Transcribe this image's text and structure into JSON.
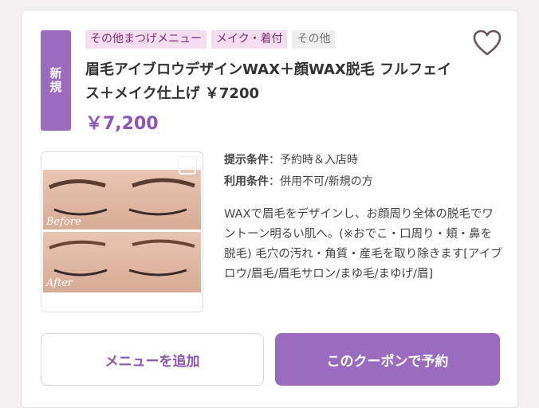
{
  "coupon": {
    "badge": "新規",
    "tags": [
      "その他まつげメニュー",
      "メイク・着付",
      "その他"
    ],
    "title": "眉毛アイブロウデザインWAX＋顔WAX脱毛 フルフェイス＋メイク仕上げ ￥7200",
    "price": "￥7,200",
    "photo_labels": {
      "before": "Before",
      "after": "After"
    },
    "conditions": [
      {
        "label": "提示条件",
        "value": "：予約時＆入店時"
      },
      {
        "label": "利用条件",
        "value": "：併用不可/新規の方"
      }
    ],
    "description": "WAXで眉毛をデザインし、お顔周り全体の脱毛でワントーン明るい肌へ。(※おでこ・口周り・頬・鼻を脱毛) 毛穴の汚れ・角質・産毛を取り除きます[アイブロウ/眉毛/眉毛サロン/まゆ毛/まゆげ/眉]",
    "buttons": {
      "add": "メニューを追加",
      "reserve": "このクーポンで予約"
    }
  },
  "colors": {
    "accent": "#9b6bc0",
    "tag_pink": "#f6dcef",
    "price": "#8a55b4"
  },
  "icons": {
    "favorite": "heart-outline-icon"
  }
}
